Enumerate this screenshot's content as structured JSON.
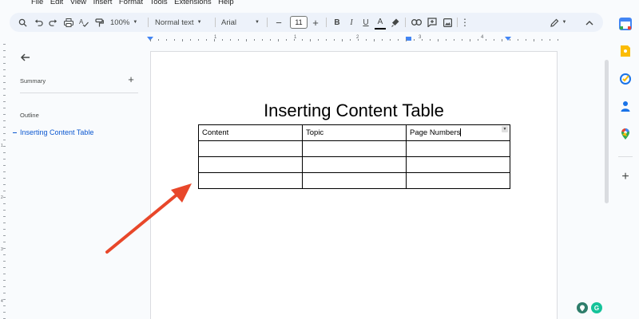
{
  "menu": {
    "items": [
      "File",
      "Edit",
      "View",
      "Insert",
      "Format",
      "Tools",
      "Extensions",
      "Help"
    ]
  },
  "toolbar": {
    "zoom": "100%",
    "style": "Normal text",
    "font": "Arial",
    "font_size": "11",
    "minus": "−",
    "plus": "+",
    "bold": "B",
    "italic": "I",
    "underline": "U",
    "text_color": "A",
    "more": "⋮"
  },
  "ruler": {
    "numbers": [
      "1",
      "1",
      "2",
      "3",
      "4",
      "5",
      "6",
      "7"
    ]
  },
  "side_ruler": {
    "numbers": [
      "1",
      "2",
      "3",
      "4"
    ]
  },
  "sidebar": {
    "summary_label": "Summary",
    "add_label": "+",
    "outline_label": "Outline",
    "outline_items": [
      {
        "label": "Inserting Content Table"
      }
    ]
  },
  "document": {
    "title": "Inserting Content Table",
    "table": {
      "headers": [
        "Content",
        "Topic",
        "Page Numbers"
      ],
      "rows": [
        [
          "",
          "",
          ""
        ],
        [
          "",
          "",
          ""
        ],
        [
          "",
          "",
          ""
        ]
      ]
    }
  },
  "right_bar": {
    "add_label": "+"
  },
  "colors": {
    "accent_blue": "#0b57d0",
    "arrow_red": "#e8472a",
    "toolbar_bg": "#edf2fa",
    "keep_yellow": "#fbbc04",
    "tasks_blue": "#1a73e8",
    "contacts_blue": "#1a73e8",
    "grammarly_green": "#15c39a"
  },
  "icons": {
    "search": "search-icon",
    "undo": "undo-icon",
    "redo": "redo-icon",
    "print": "print-icon",
    "spellcheck": "spellcheck-icon",
    "paint_format": "paint-format-icon",
    "highlight": "highlighter-icon",
    "link": "link-icon",
    "comment": "add-comment-icon",
    "image": "insert-image-icon",
    "edit_mode": "pencil-icon",
    "back": "arrow-left-icon",
    "calendar": "calendar-icon",
    "keep": "keep-icon",
    "tasks": "tasks-icon",
    "contacts": "contacts-icon",
    "maps": "maps-icon"
  }
}
